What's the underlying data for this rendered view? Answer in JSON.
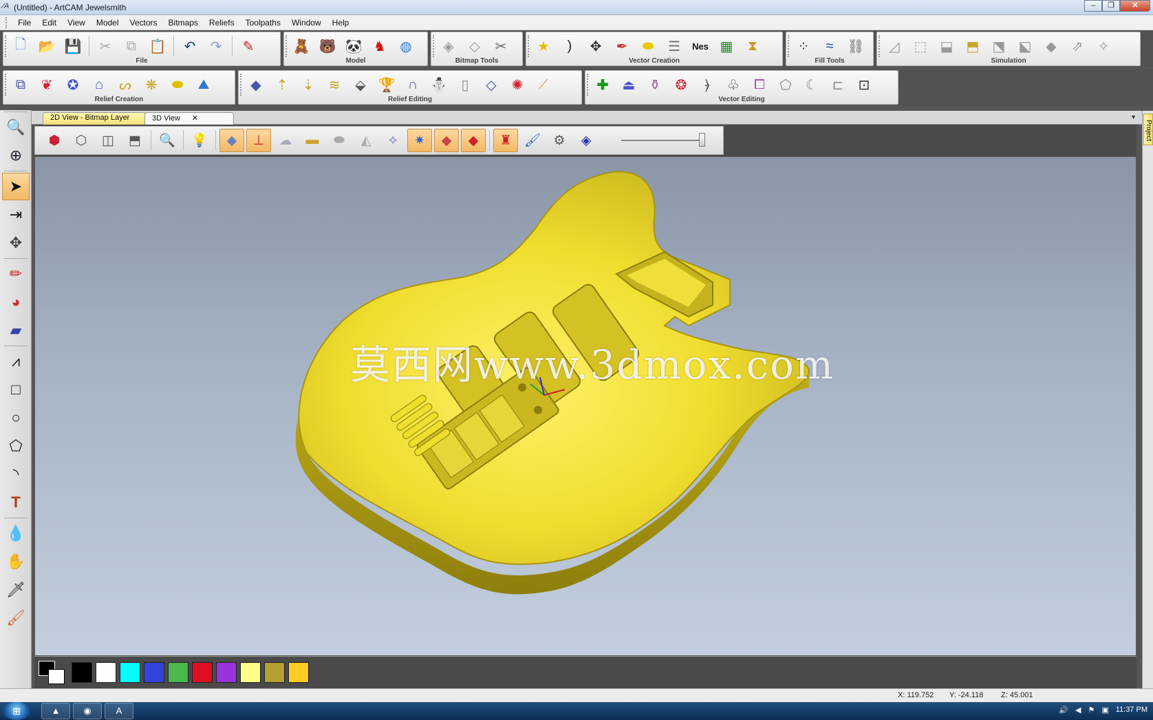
{
  "window": {
    "title": "(Untitled) - ArtCAM Jewelsmith",
    "min": "–",
    "max": "❐",
    "close": "✕"
  },
  "menu": [
    "File",
    "Edit",
    "View",
    "Model",
    "Vectors",
    "Bitmaps",
    "Reliefs",
    "Toolpaths",
    "Window",
    "Help"
  ],
  "toolbar_row1": [
    {
      "label": "File",
      "icons": [
        "new-file-icon",
        "open-folder-icon",
        "save-icon",
        "|",
        "cut-icon",
        "copy-icon",
        "paste-icon",
        "|",
        "undo-icon",
        "redo-icon",
        "|",
        "edit-notes-icon"
      ]
    },
    {
      "label": "Model",
      "icons": [
        "model-bear-icon",
        "model-teddy-icon",
        "model-panda-icon",
        "model-red-icon",
        "model-globe-icon"
      ]
    },
    {
      "label": "Bitmap Tools",
      "icons": [
        "bitmap-shape-icon",
        "bitmap-outline-icon",
        "bitmap-scissor-icon"
      ]
    },
    {
      "label": "Vector Creation",
      "icons": [
        "star-vector-icon",
        "arc-vector-icon",
        "node-tool-icon",
        "pen-curve-icon",
        "yellow-blob-icon",
        "stack-vector-icon",
        "nesting-icon",
        "text-block-icon",
        "layer-stack-icon"
      ]
    },
    {
      "label": "Fill Tools",
      "icons": [
        "dots-fill-icon",
        "wave-fill-icon",
        "chain-fill-icon"
      ]
    },
    {
      "label": "Simulation",
      "icons": [
        "sim-1-icon",
        "sim-2-icon",
        "sim-3-icon",
        "sim-4-icon",
        "sim-5-icon",
        "sim-6-icon",
        "sim-7-icon",
        "sim-8-icon",
        "sim-9-icon"
      ]
    }
  ],
  "toolbar_row2": [
    {
      "label": "Relief Creation",
      "icons": [
        "layers-relief-icon",
        "leaf-relief-icon",
        "star-relief-icon",
        "sweep-relief-icon",
        "s-curve-icon",
        "weave-icon",
        "spread-relief-icon",
        "mountain-relief-icon"
      ]
    },
    {
      "label": "Relief Editing",
      "icons": [
        "plane-relief-icon",
        "spray-up-icon",
        "spray-down-icon",
        "smooth-relief-icon",
        "stamp-relief-icon",
        "trophy-icon",
        "arch-relief-icon",
        "gnome-icon",
        "column-relief-icon",
        "tilt-relief-icon",
        "sparkle-relief-icon",
        "slice-relief-icon"
      ]
    },
    {
      "label": "Vector Editing",
      "icons": [
        "add-green-icon",
        "pedestal-icon",
        "vase-icon",
        "border-icon",
        "bracket-icon",
        "scroll-icon",
        "frame-icon",
        "offset-icon",
        "curve-a-icon",
        "curve-b-icon",
        "transform-box-icon"
      ]
    }
  ],
  "tabs": {
    "bitmap": "2D View - Bitmap Layer",
    "threed": "3D View",
    "close": "✕",
    "dropdown": "▼"
  },
  "project_tab": "Project",
  "view_toolbar": {
    "icons": [
      "iso-view-icon",
      "front-view-icon",
      "side-view-icon",
      "top-view-icon",
      "|",
      "zoom-icon",
      "|",
      "light-bulb-icon",
      "|",
      "plane-toggle-icon",
      "axes-toggle-icon",
      "relief-shade-icon",
      "bar-relief-icon",
      "flat-relief-icon",
      "wire-relief-icon",
      "vector-view-icon",
      "star-display-icon",
      "layer-display-icon",
      "color-layer-icon",
      "|",
      "material-icon",
      "paint-brush-icon",
      "settings-gear-icon",
      "gem-icon"
    ],
    "active": [
      "plane-toggle-icon",
      "axes-toggle-icon",
      "star-display-icon",
      "layer-display-icon",
      "color-layer-icon",
      "material-icon"
    ],
    "slider_value": 1.0
  },
  "viewport": {
    "watermark": "莫西网www.3dmox.com",
    "model": "guitar-body"
  },
  "palette": {
    "foreground": "#000000",
    "background": "#ffffff",
    "colors": [
      "#000000",
      "#ffffff",
      "#00ffff",
      "#3344dd",
      "#4cb84c",
      "#dd1122",
      "#9933dd",
      "#ffff88",
      "#b5a132",
      "#ffcc22"
    ]
  },
  "status": {
    "x": "X: 119.752",
    "y": "Y: -24.118",
    "z": "Z: 45.001"
  },
  "taskbar": {
    "start": "⊞",
    "apps": [
      "vlc-icon",
      "chrome-icon",
      "artcam-icon"
    ],
    "tray_time": "11:37 PM",
    "tray_icons": [
      "volume-icon",
      "speaker-icon",
      "flag-icon",
      "network-icon"
    ]
  },
  "left_tools": [
    "zoom-region-icon",
    "globe-view-icon",
    "-",
    "select-arrow-icon",
    "node-edit-icon",
    "transform-icon",
    "-",
    "pencil-icon",
    "paint-bucket-icon",
    "eraser-icon",
    "-",
    "polyline-icon",
    "rectangle-icon",
    "circle-icon",
    "polygon-icon",
    "arc-icon",
    "text-tool-icon",
    "-",
    "drop-icon",
    "sculpt-icon",
    "knife-icon",
    "brush-icon"
  ]
}
